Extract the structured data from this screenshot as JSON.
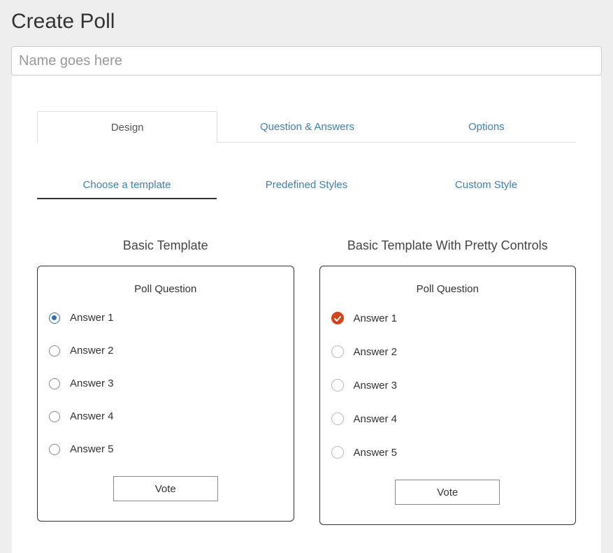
{
  "page": {
    "title": "Create Poll",
    "name_placeholder": "Name goes here"
  },
  "tabs": {
    "design": "Design",
    "qa": "Question & Answers",
    "options": "Options"
  },
  "subtabs": {
    "choose": "Choose a template",
    "predefined": "Predefined Styles",
    "custom": "Custom Style"
  },
  "templates": {
    "basic": {
      "title": "Basic Template",
      "question": "Poll Question",
      "answers": [
        "Answer 1",
        "Answer 2",
        "Answer 3",
        "Answer 4",
        "Answer 5"
      ],
      "selected_index": 0,
      "vote_label": "Vote"
    },
    "pretty": {
      "title": "Basic Template With Pretty Controls",
      "question": "Poll Question",
      "answers": [
        "Answer 1",
        "Answer 2",
        "Answer 3",
        "Answer 4",
        "Answer 5"
      ],
      "selected_index": 0,
      "vote_label": "Vote"
    }
  },
  "colors": {
    "link": "#3a7fc4",
    "accent_native": "#2f6fb5",
    "accent_pretty": "#d84315"
  }
}
